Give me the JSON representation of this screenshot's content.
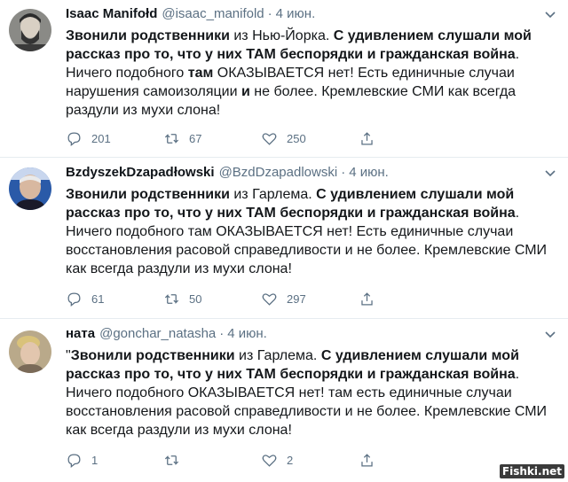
{
  "tweets": [
    {
      "name": "Isaac Manifołd",
      "handle": "@isaac_manifold",
      "separator": "·",
      "date": "4 июн.",
      "body": [
        {
          "t": "Звонили родственники",
          "b": true
        },
        {
          "t": " из Нью-Йорка. ",
          "b": false
        },
        {
          "t": "С удивлением слушали мой рассказ про то, что у них ТАМ беспорядки и гражданская война",
          "b": true
        },
        {
          "t": ". Ничего подобного ",
          "b": false
        },
        {
          "t": "там",
          "b": true
        },
        {
          "t": " ОКАЗЫВАЕТСЯ нет! Есть единичные случаи нарушения самоизоляции ",
          "b": false
        },
        {
          "t": "и",
          "b": true
        },
        {
          "t": " не более. Кремлевские СМИ как всегда раздули из мухи слона!",
          "b": false
        }
      ],
      "replies": "201",
      "retweets": "67",
      "likes": "250"
    },
    {
      "name": "BzdyszekDzapadłowski",
      "handle": "@BzdDzapadlowski",
      "separator": "·",
      "date": "4 июн.",
      "body": [
        {
          "t": "Звонили родственники",
          "b": true
        },
        {
          "t": " из Гарлема. ",
          "b": false
        },
        {
          "t": "С удивлением слушали мой рассказ про то, что у них ТАМ беспорядки и гражданская война",
          "b": true
        },
        {
          "t": ". Ничего подобного там ОКАЗЫВАЕТСЯ нет! Есть единичные случаи восстановления расовой справедливости и не более. Кремлевские СМИ как всегда раздули из мухи слона!",
          "b": false
        }
      ],
      "replies": "61",
      "retweets": "50",
      "likes": "297"
    },
    {
      "name": "ната",
      "handle": "@gonchar_natasha",
      "separator": "·",
      "date": "4 июн.",
      "body": [
        {
          "t": "\"",
          "b": false
        },
        {
          "t": "Звонили родственники",
          "b": true
        },
        {
          "t": " из Гарлема. ",
          "b": false
        },
        {
          "t": "С удивлением слушали мой рассказ про то, что у них ТАМ беспорядки и гражданская война",
          "b": true
        },
        {
          "t": ". Ничего подобного ОКАЗЫВАЕТСЯ нет! там есть единичные случаи восстановления расовой справедливости и не более. Кремлевские СМИ как всегда раздули из мухи слона!",
          "b": false
        }
      ],
      "replies": "1",
      "retweets": "",
      "likes": "2"
    }
  ],
  "watermark": "Fishki.net",
  "colors": {
    "text": "#0f1419",
    "secondary": "#5b7083",
    "border": "#e6ecf0"
  }
}
